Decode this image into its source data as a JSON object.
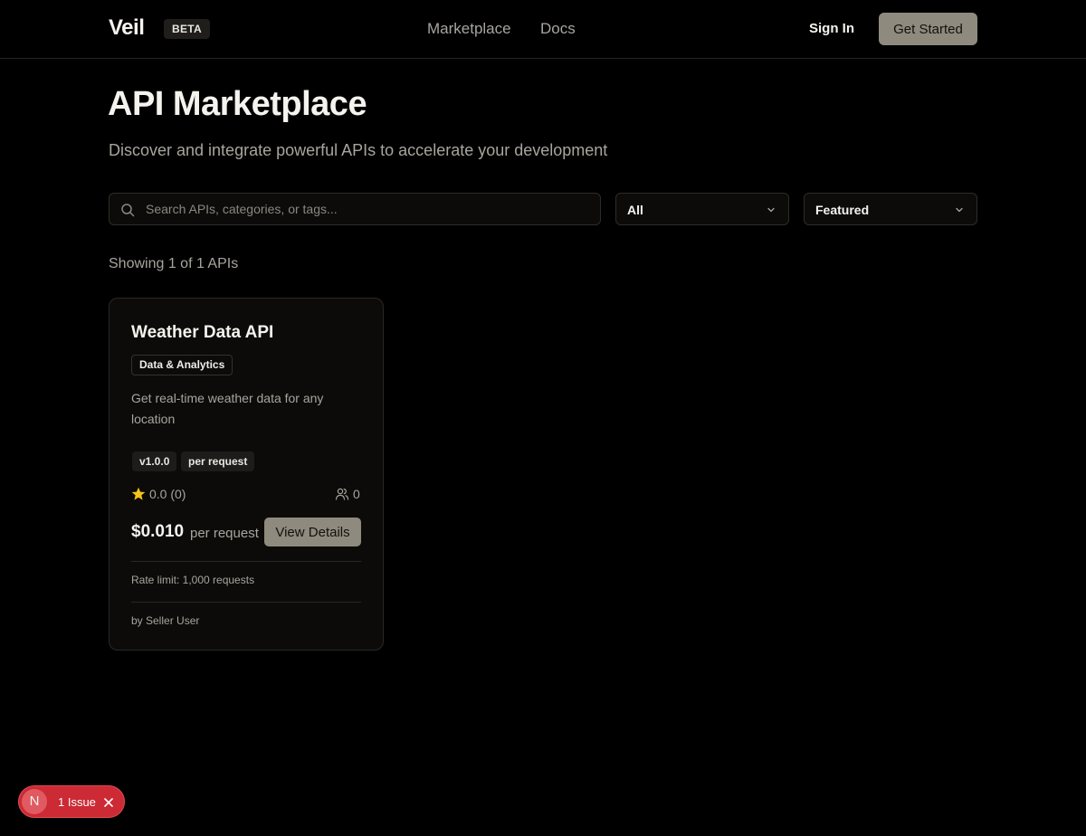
{
  "header": {
    "logo": "Veil",
    "badge": "BETA",
    "nav": [
      {
        "label": "Marketplace"
      },
      {
        "label": "Docs"
      }
    ],
    "sign_in": "Sign In",
    "get_started": "Get Started"
  },
  "hero": {
    "title": "API Marketplace",
    "subtitle": "Discover and integrate powerful APIs to accelerate your development"
  },
  "filters": {
    "search_placeholder": "Search APIs, categories, or tags...",
    "search_value": "",
    "category_selected": "All",
    "sort_selected": "Featured"
  },
  "results": {
    "count_text": "Showing 1 of 1 APIs"
  },
  "apis": [
    {
      "name": "Weather Data API",
      "category": "Data & Analytics",
      "description": "Get real-time weather data for any location",
      "version": "v1.0.0",
      "pricing_model": "per request",
      "rating": "0.0 (0)",
      "users": "0",
      "price": "$0.010",
      "price_unit": "per request",
      "view_details": "View Details",
      "rate_limit": "Rate limit: 1,000 requests",
      "seller": "by Seller User"
    }
  ],
  "dev_overlay": {
    "badge": "N",
    "label": "1 Issue"
  },
  "colors": {
    "background": "#000000",
    "accent_button": "#8f8a7e",
    "star": "#f5c518",
    "issue_pill": "#cc2a34"
  }
}
